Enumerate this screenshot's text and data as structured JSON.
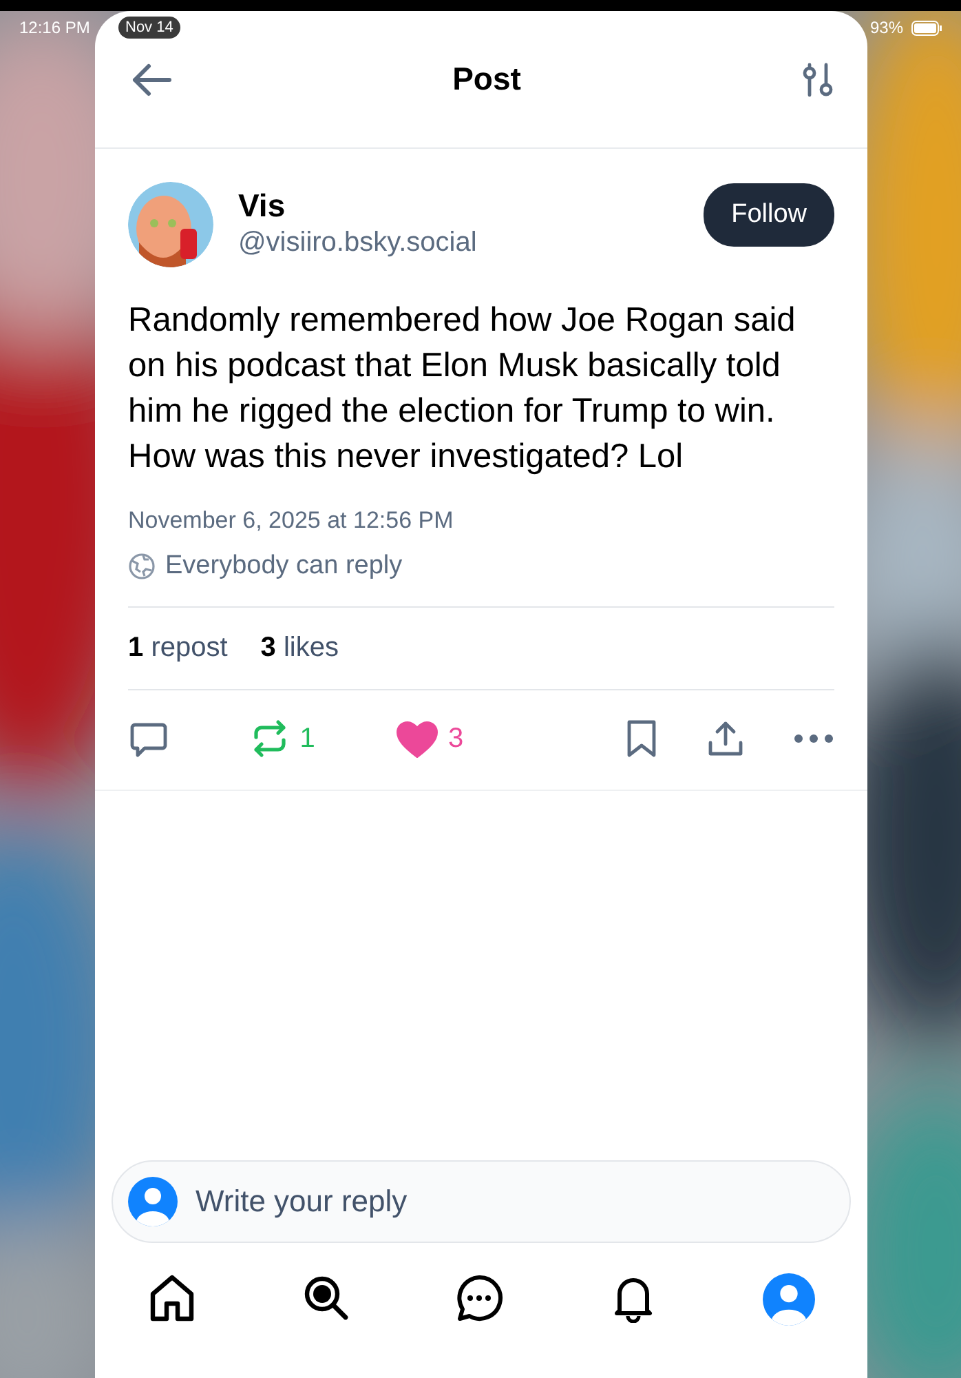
{
  "status_bar": {
    "time": "12:16 PM",
    "date_pill": "Nov 14",
    "battery": "93%"
  },
  "header": {
    "title": "Post"
  },
  "post": {
    "author": {
      "name": "Vis",
      "handle": "@visiiro.bsky.social"
    },
    "follow_button": "Follow",
    "text": "Randomly remembered how Joe Rogan said on his podcast that Elon Musk basically told him he rigged the election for Trump to win.\nHow was this never investigated? Lol",
    "timestamp": "November 6, 2025 at 12:56 PM",
    "reply_setting": "Everybody can reply",
    "stats": [
      {
        "count": "1",
        "label": "repost"
      },
      {
        "count": "3",
        "label": "likes"
      }
    ],
    "actions": {
      "reposted": true,
      "repost_count": "1",
      "liked": true,
      "like_count": "3"
    }
  },
  "reply": {
    "placeholder": "Write your reply"
  }
}
